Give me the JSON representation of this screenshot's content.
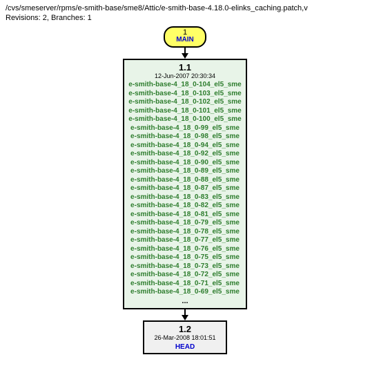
{
  "header": {
    "path": "/cvs/smeserver/rpms/e-smith-base/sme8/Attic/e-smith-base-4.18.0-elinks_caching.patch,v",
    "meta": "Revisions: 2, Branches: 1"
  },
  "branch": {
    "number": "1",
    "name": "MAIN"
  },
  "rev1": {
    "number": "1.1",
    "timestamp": "12-Jun-2007 20:30:34",
    "tags": [
      "e-smith-base-4_18_0-104_el5_sme",
      "e-smith-base-4_18_0-103_el5_sme",
      "e-smith-base-4_18_0-102_el5_sme",
      "e-smith-base-4_18_0-101_el5_sme",
      "e-smith-base-4_18_0-100_el5_sme",
      "e-smith-base-4_18_0-99_el5_sme",
      "e-smith-base-4_18_0-98_el5_sme",
      "e-smith-base-4_18_0-94_el5_sme",
      "e-smith-base-4_18_0-92_el5_sme",
      "e-smith-base-4_18_0-90_el5_sme",
      "e-smith-base-4_18_0-89_el5_sme",
      "e-smith-base-4_18_0-88_el5_sme",
      "e-smith-base-4_18_0-87_el5_sme",
      "e-smith-base-4_18_0-83_el5_sme",
      "e-smith-base-4_18_0-82_el5_sme",
      "e-smith-base-4_18_0-81_el5_sme",
      "e-smith-base-4_18_0-79_el5_sme",
      "e-smith-base-4_18_0-78_el5_sme",
      "e-smith-base-4_18_0-77_el5_sme",
      "e-smith-base-4_18_0-76_el5_sme",
      "e-smith-base-4_18_0-75_el5_sme",
      "e-smith-base-4_18_0-73_el5_sme",
      "e-smith-base-4_18_0-72_el5_sme",
      "e-smith-base-4_18_0-71_el5_sme",
      "e-smith-base-4_18_0-69_el5_sme"
    ],
    "ellipsis": "..."
  },
  "rev2": {
    "number": "1.2",
    "timestamp": "26-Mar-2008 18:01:51",
    "head": "HEAD"
  },
  "chart_data": {
    "type": "table",
    "title": "CVS Revision Graph",
    "file": "e-smith-base-4.18.0-elinks_caching.patch,v",
    "branches": [
      {
        "number": "1",
        "name": "MAIN"
      }
    ],
    "revisions": [
      {
        "number": "1.1",
        "timestamp": "12-Jun-2007 20:30:34",
        "tag_count_shown": 25,
        "truncated": true
      },
      {
        "number": "1.2",
        "timestamp": "26-Mar-2008 18:01:51",
        "labels": [
          "HEAD"
        ],
        "state": "dead"
      }
    ],
    "totals": {
      "revisions": 2,
      "branches": 1
    }
  }
}
